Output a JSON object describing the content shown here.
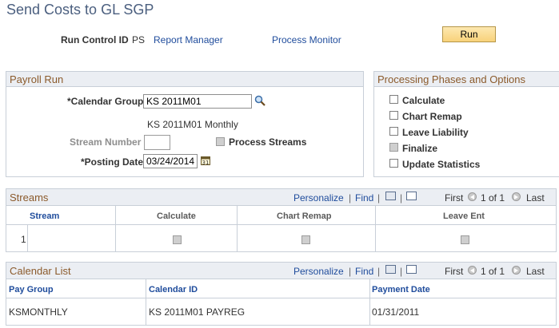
{
  "page": {
    "title": "Send Costs to GL SGP"
  },
  "run_control": {
    "label": "Run Control ID",
    "value": "PS",
    "report_manager": "Report Manager",
    "process_monitor": "Process Monitor",
    "run_button": "Run"
  },
  "payroll_run": {
    "header": "Payroll Run",
    "calendar_group_label": "*Calendar Group",
    "calendar_group_value": "KS 2011M01",
    "calendar_group_desc": "KS 2011M01 Monthly",
    "stream_number_label": "Stream Number",
    "stream_number_value": "",
    "process_streams_label": "Process Streams",
    "posting_date_label": "*Posting Date",
    "posting_date_value": "03/24/2014"
  },
  "phases": {
    "header": "Processing Phases and Options",
    "options": [
      {
        "label": "Calculate",
        "disabled": false
      },
      {
        "label": "Chart Remap",
        "disabled": false
      },
      {
        "label": "Leave Liability",
        "disabled": false
      },
      {
        "label": "Finalize",
        "disabled": true
      },
      {
        "label": "Update Statistics",
        "disabled": false
      }
    ]
  },
  "streams": {
    "header": "Streams",
    "personalize": "Personalize",
    "find": "Find",
    "first": "First",
    "range": "1 of 1",
    "last": "Last",
    "columns": [
      "Stream",
      "Calculate",
      "Chart Remap",
      "Leave Ent"
    ],
    "rows": [
      {
        "num": "1"
      }
    ]
  },
  "calendar_list": {
    "header": "Calendar List",
    "personalize": "Personalize",
    "find": "Find",
    "first": "First",
    "range": "1 of 1",
    "last": "Last",
    "columns": [
      "Pay Group",
      "Calendar ID",
      "Payment Date"
    ],
    "rows": [
      {
        "pay_group": "KSMONTHLY",
        "calendar_id": "KS 2011M01 PAYREG",
        "payment_date": "01/31/2011"
      }
    ]
  }
}
